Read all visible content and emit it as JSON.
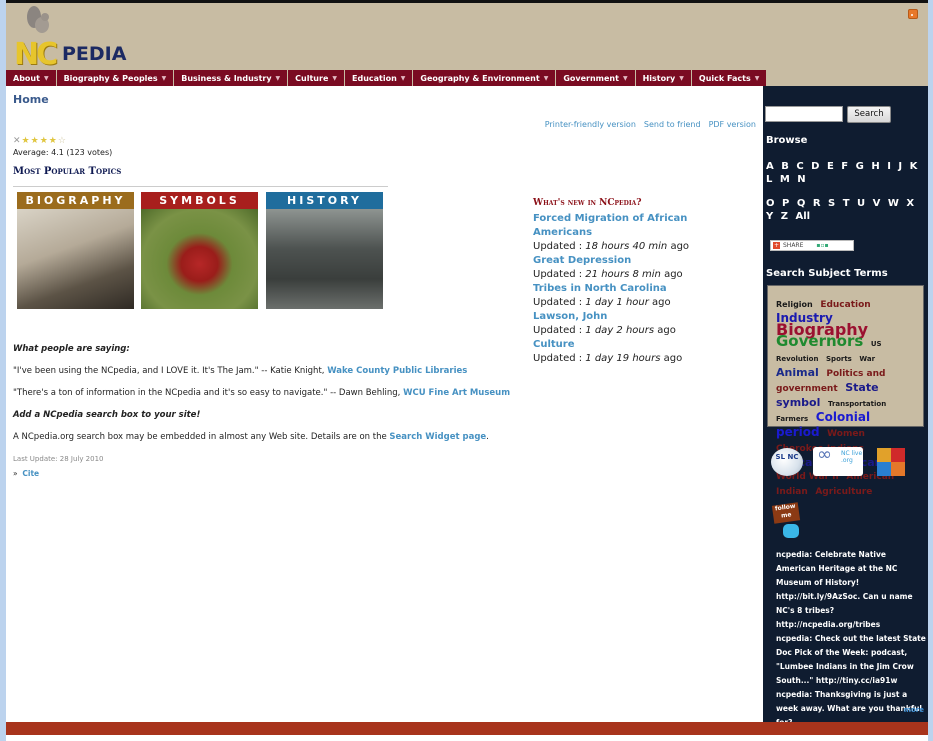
{
  "header": {
    "logo_nc": "NC",
    "logo_pedia": "PEDIA",
    "rss_icon": "rss-icon"
  },
  "nav": {
    "items": [
      {
        "label": "About"
      },
      {
        "label": "Biography & Peoples"
      },
      {
        "label": "Business & Industry"
      },
      {
        "label": "Culture"
      },
      {
        "label": "Education"
      },
      {
        "label": "Geography & Environment"
      },
      {
        "label": "Government"
      },
      {
        "label": "History"
      },
      {
        "label": "Quick Facts"
      }
    ],
    "caret": "▼"
  },
  "main": {
    "breadcrumb": "Home",
    "print_links": [
      "Printer-friendly version",
      "Send to friend",
      "PDF version"
    ],
    "rating": {
      "cancel": "✕",
      "stars_filled": 4,
      "stars_total": 5,
      "average_text": "Average: 4.1 (123 votes)"
    },
    "popular_title": "Most Popular Topics",
    "topics": [
      {
        "label": "BIOGRAPHY"
      },
      {
        "label": "SYMBOLS"
      },
      {
        "label": "HISTORY"
      }
    ],
    "whats_new": {
      "title": "What's new in NCpedia?",
      "items": [
        {
          "title": "Forced Migration of African Americans",
          "prefix": "Updated : ",
          "time": "18 hours 40 min",
          "suffix": " ago"
        },
        {
          "title": "Great Depression",
          "prefix": "Updated : ",
          "time": "21 hours 8 min",
          "suffix": " ago"
        },
        {
          "title": "Tribes in North Carolina",
          "prefix": "Updated : ",
          "time": "1 day 1 hour",
          "suffix": " ago"
        },
        {
          "title": "Lawson, John",
          "prefix": "Updated : ",
          "time": "1 day 2 hours",
          "suffix": " ago"
        },
        {
          "title": "Culture",
          "prefix": "Updated : ",
          "time": "1 day 19 hours",
          "suffix": " ago"
        }
      ]
    },
    "saying": {
      "heading": "What people are saying:",
      "quote1_text": "\"I've been using the NCpedia, and I LOVE it.  It's The Jam.\" -- Katie Knight, ",
      "quote1_link": "Wake County Public Libraries",
      "quote2_text": "\"There's a ton of information in the NCpedia and it's so easy to navigate.\" -- Dawn Behling, ",
      "quote2_link": "WCU  Fine Art Museum",
      "widget_heading": "Add a NCpedia search box to your site!",
      "widget_text": "A NCpedia.org search box may be embedded in almost any Web site. Details are on the ",
      "widget_link": "Search Widget page",
      "widget_end": ".",
      "last_update": "Last Update: 28 July 2010",
      "cite_marker": "»",
      "cite_link": "Cite"
    }
  },
  "sidebar": {
    "search_value": "",
    "search_button": "Search",
    "browse_title": "Browse",
    "letters_row1": [
      "A",
      "B",
      "C",
      "D",
      "E",
      "F",
      "G",
      "H",
      "I",
      "J",
      "K",
      "L",
      "M",
      "N"
    ],
    "letters_row2": [
      "O",
      "P",
      "Q",
      "R",
      "S",
      "T",
      "U",
      "V",
      "W",
      "X",
      "Y",
      "Z",
      "All"
    ],
    "share_label": "SHARE",
    "subject_title": "Search Subject Terms",
    "tag_cloud": [
      {
        "term": "Religion",
        "size": 8,
        "color": "#1a1a1a"
      },
      {
        "term": "Education",
        "size": 9,
        "color": "#7a1a1a"
      },
      {
        "term": "Industry",
        "size": 12,
        "color": "#1a1ab0"
      },
      {
        "term": "Biography",
        "size": 16,
        "color": "#9b1030"
      },
      {
        "term": "Governors",
        "size": 15,
        "color": "#1f8a2f"
      },
      {
        "term": "US",
        "size": 7,
        "color": "#1a1a1a"
      },
      {
        "term": "Revolution",
        "size": 7,
        "color": "#1a1a1a"
      },
      {
        "term": "Sports",
        "size": 7,
        "color": "#1a1a1a"
      },
      {
        "term": "War",
        "size": 7,
        "color": "#1a1a1a"
      },
      {
        "term": "Animal",
        "size": 11,
        "color": "#1a2a8a"
      },
      {
        "term": "Politics and government",
        "size": 9,
        "color": "#7a1a1a"
      },
      {
        "term": "State symbol",
        "size": 11,
        "color": "#1a1a8a"
      },
      {
        "term": "Transportation",
        "size": 7,
        "color": "#1a1a1a"
      },
      {
        "term": "Farmers",
        "size": 7,
        "color": "#1a1a1a"
      },
      {
        "term": "Colonial period",
        "size": 12,
        "color": "#1a1ad0"
      },
      {
        "term": "Women",
        "size": 9,
        "color": "#7a1a1a"
      },
      {
        "term": "Cherokee Indians",
        "size": 9,
        "color": "#7a1a1a"
      },
      {
        "term": "African American",
        "size": 11,
        "color": "#1a1a8a"
      },
      {
        "term": "World War II",
        "size": 9,
        "color": "#7a1a1a"
      },
      {
        "term": "American Indian",
        "size": 9,
        "color": "#7a1a1a"
      },
      {
        "term": "Agriculture",
        "size": 9,
        "color": "#7a1a1a"
      }
    ],
    "partners": {
      "slnc": "SL NC",
      "nclive": "NC live .org"
    },
    "follow_label": "follow me",
    "tweets": [
      "ncpedia: Celebrate Native American Heritage at the NC Museum of History! http://bit.ly/9AzSoc. Can u name NC's 8 tribes? http://ncpedia.org/tribes",
      "ncpedia: Check out the latest State Doc Pick of the Week: podcast, \"Lumbee Indians in the Jim Crow South...\" http://tiny.cc/ia91w",
      "ncpedia: Thanksgiving is just a week away. What are you thankful for?"
    ],
    "more_link": "more"
  }
}
